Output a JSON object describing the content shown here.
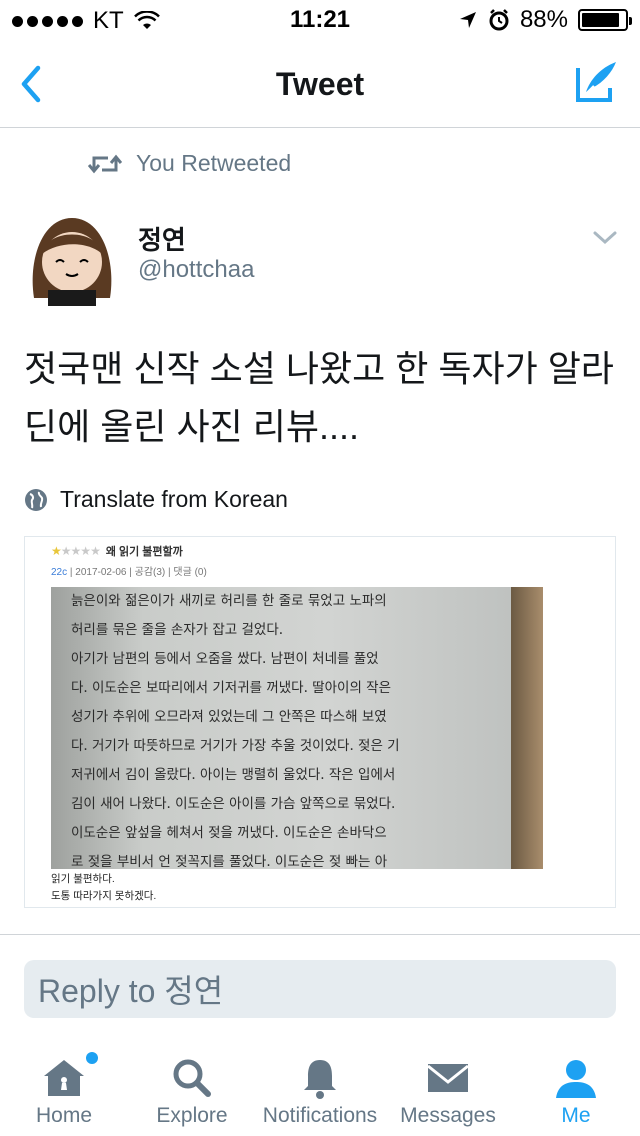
{
  "status_bar": {
    "carrier": "KT",
    "time": "11:21",
    "battery": "88%",
    "battery_level": 0.88
  },
  "nav": {
    "title": "Tweet",
    "back_icon": "chevron-left-icon",
    "compose_icon": "compose-icon"
  },
  "retweet_context": {
    "text": "You Retweeted",
    "icon": "retweet-icon"
  },
  "tweet": {
    "author_name": "정연",
    "author_handle": "@hottchaa",
    "text": "젓국맨 신작 소설 나왔고 한 독자가 알라딘에 올린 사진 리뷰....",
    "translate_label": "Translate from Korean"
  },
  "photo": {
    "review_title": "왜 읽기 불편할까",
    "rating": 1,
    "rating_max": 5,
    "meta_id": "22c",
    "meta_date": "2017-02-06",
    "meta_likes": "공감(3)",
    "meta_comments": "댓글 (0)",
    "book_lines": [
      "늙은이와 젊은이가 새끼로 허리를 한 줄로 묶었고 노파의",
      "허리를 묶은 줄을 손자가 잡고 걸었다.",
      "  아기가 남편의 등에서 오줌을 쌌다. 남편이 처네를 풀었",
      "다. 이도순은 보따리에서 기저귀를 꺼냈다. 딸아이의 작은",
      "성기가 추위에 오므라져 있었는데 그 안쪽은 따스해 보였",
      "다. 거기가 따뜻하므로 거기가 가장 추울 것이었다. 젖은 기",
      "저귀에서 김이 올랐다. 아이는 맹렬히 울었다. 작은 입에서",
      "김이 새어 나왔다. 이도순은 아이를 가슴 앞쪽으로 묶었다.",
      "이도순은 앞섶을 헤쳐서 젖을 꺼냈다. 이도순은 손바닥으",
      "로 젖을 부비서 언 젖꼭지를 풀었다. 이도순은 젖 빠는 아"
    ],
    "caption_lines": [
      "읽기 불편하다.",
      "도통 따라가지 못하겠다."
    ]
  },
  "reply": {
    "placeholder": "Reply to 정연"
  },
  "tabs": [
    {
      "label": "Home",
      "icon": "home-icon",
      "active": false,
      "has_dot": true
    },
    {
      "label": "Explore",
      "icon": "search-icon",
      "active": false
    },
    {
      "label": "Notifications",
      "icon": "bell-icon",
      "active": false
    },
    {
      "label": "Messages",
      "icon": "envelope-icon",
      "active": false
    },
    {
      "label": "Me",
      "icon": "person-icon",
      "active": true
    }
  ],
  "colors": {
    "accent": "#1da1f2",
    "secondary_text": "#657786",
    "primary_text": "#14171a"
  }
}
